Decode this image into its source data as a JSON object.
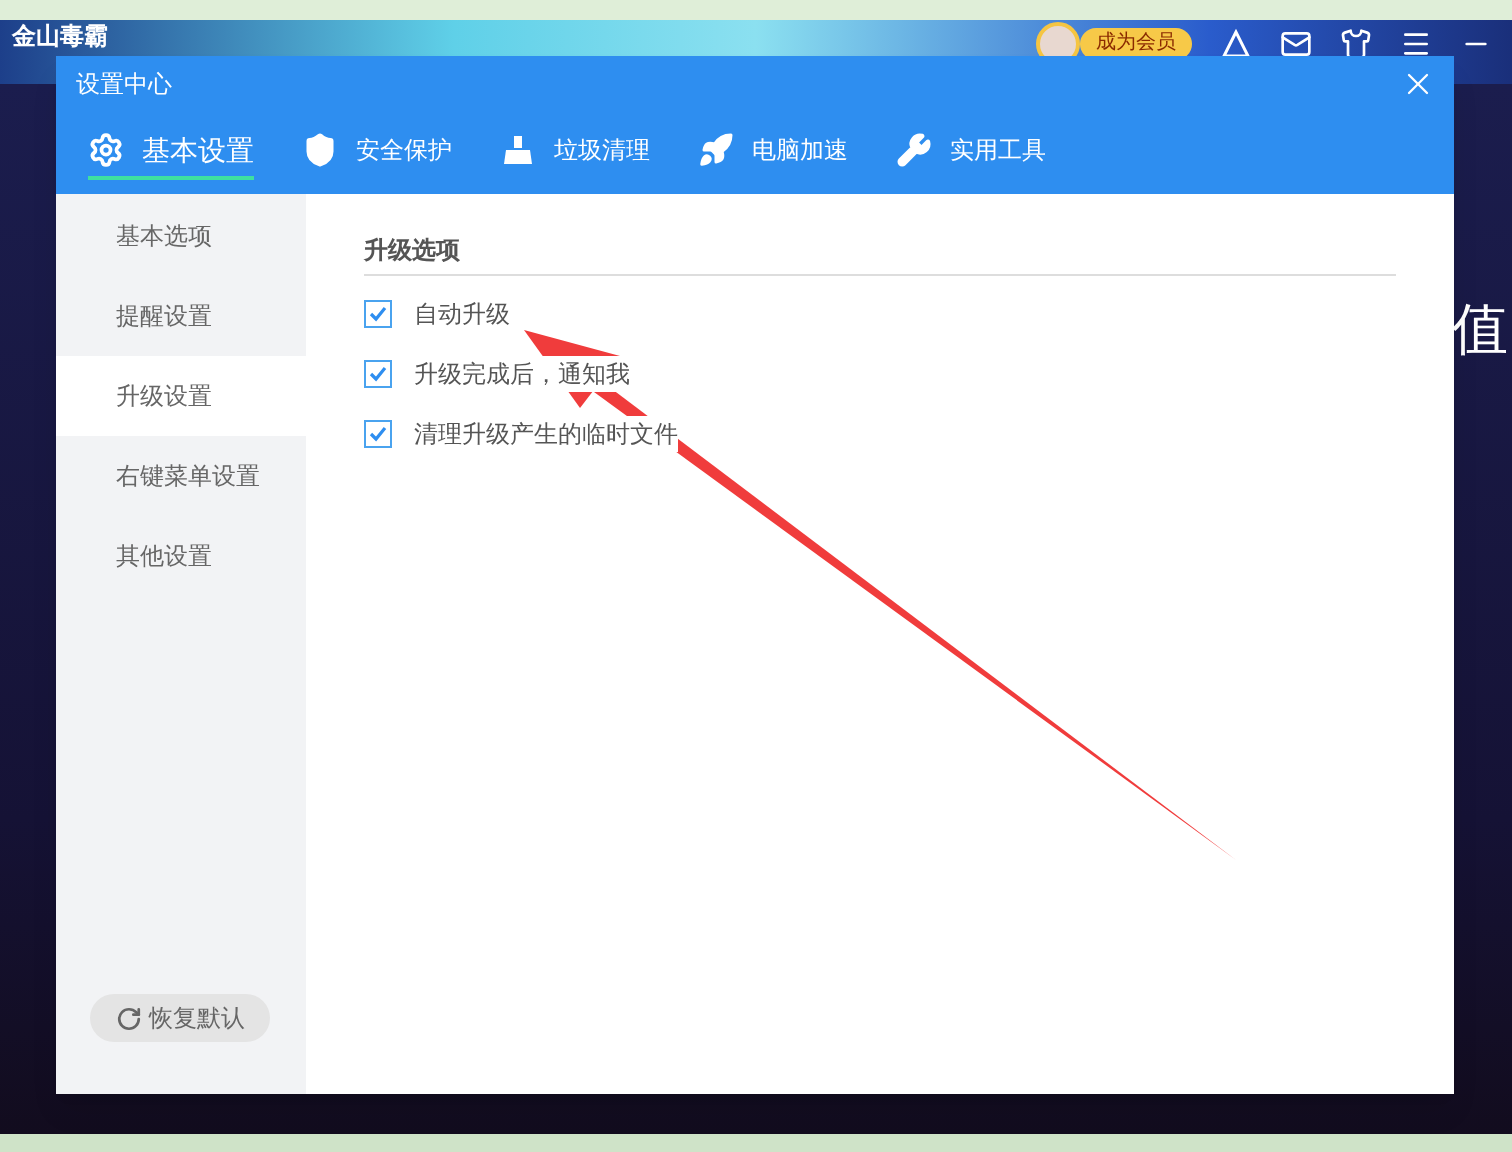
{
  "app": {
    "logo": "金山毒霸",
    "member_button": "成为会员",
    "side_glyph": "值"
  },
  "dialog": {
    "title": "设置中心",
    "tabs": [
      {
        "label": "基本设置",
        "selected": true
      },
      {
        "label": "安全保护",
        "selected": false
      },
      {
        "label": "垃圾清理",
        "selected": false
      },
      {
        "label": "电脑加速",
        "selected": false
      },
      {
        "label": "实用工具",
        "selected": false
      }
    ],
    "sidebar": {
      "items": [
        {
          "label": "基本选项",
          "selected": false
        },
        {
          "label": "提醒设置",
          "selected": false
        },
        {
          "label": "升级设置",
          "selected": true
        },
        {
          "label": "右键菜单设置",
          "selected": false
        },
        {
          "label": "其他设置",
          "selected": false
        }
      ],
      "reset_button": "恢复默认"
    },
    "section_title": "升级选项",
    "options": [
      {
        "label": "自动升级",
        "checked": true
      },
      {
        "label": "升级完成后，通知我",
        "checked": true
      },
      {
        "label": "清理升级产生的临时文件",
        "checked": true
      }
    ]
  }
}
